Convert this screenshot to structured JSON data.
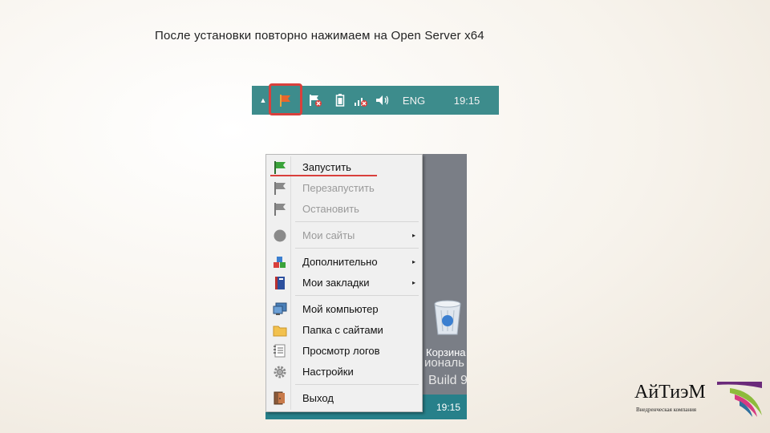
{
  "slide": {
    "title": "После установки повторно нажимаем на Open Server x64"
  },
  "taskbar": {
    "arrow": "▲",
    "lang": "ENG",
    "time": "19:15",
    "icons": [
      "tray-arrow-icon",
      "openserver-flag-icon",
      "flag-x-icon",
      "battery-icon",
      "network-x-icon",
      "volume-icon"
    ]
  },
  "menu": {
    "items": [
      {
        "label": "Запустить",
        "icon": "green-flag-icon",
        "enabled": true
      },
      {
        "label": "Перезапустить",
        "icon": "grey-flag-icon",
        "enabled": false
      },
      {
        "label": "Остановить",
        "icon": "grey-flag-icon",
        "enabled": false
      },
      {
        "label": "Мои сайты",
        "icon": "circle-icon",
        "enabled": false,
        "submenu": "▸"
      },
      {
        "label": "Дополнительно",
        "icon": "blocks-icon",
        "enabled": true,
        "submenu": "▸"
      },
      {
        "label": "Мои закладки",
        "icon": "book-icon",
        "enabled": true,
        "submenu": "▸"
      },
      {
        "label": "Мой компьютер",
        "icon": "computer-icon",
        "enabled": true
      },
      {
        "label": "Папка с сайтами",
        "icon": "folder-icon",
        "enabled": true
      },
      {
        "label": "Просмотр логов",
        "icon": "log-icon",
        "enabled": true
      },
      {
        "label": "Настройки",
        "icon": "gear-icon",
        "enabled": true
      },
      {
        "label": "Выход",
        "icon": "exit-door-icon",
        "enabled": true
      }
    ]
  },
  "desktop": {
    "recycle_label": "Корзина",
    "partial_text": "иональ",
    "build_text": "Build 9",
    "time": "19:15"
  },
  "logo": {
    "name": "АйТиэМ",
    "tagline": "Внедренческая компания"
  },
  "colors": {
    "accent_red": "#d9403c",
    "taskbar": "#3d8c8c",
    "logo_purple": "#6b2a7a",
    "logo_green": "#8dbb3c",
    "logo_pink": "#d63a82"
  }
}
